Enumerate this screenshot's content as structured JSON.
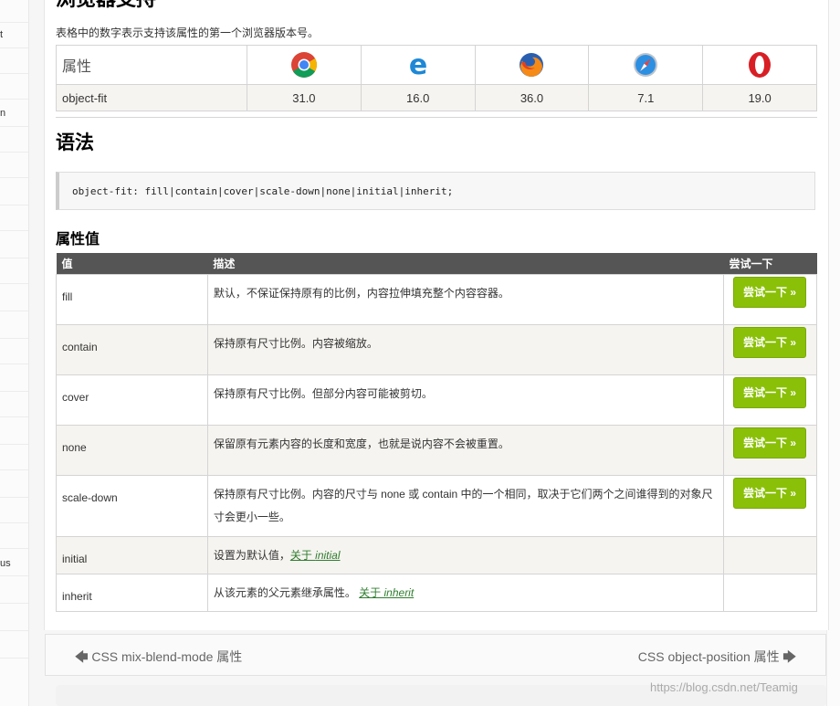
{
  "sidebar": {
    "fragments": [
      "t",
      "n",
      "us"
    ]
  },
  "browser_support": {
    "heading": "浏览器支持",
    "note": "表格中的数字表示支持该属性的第一个浏览器版本号。",
    "property_header": "属性",
    "property": "object-fit",
    "browsers": [
      {
        "icon": "chrome-icon",
        "version": "31.0"
      },
      {
        "icon": "edge-icon",
        "version": "16.0"
      },
      {
        "icon": "firefox-icon",
        "version": "36.0"
      },
      {
        "icon": "safari-icon",
        "version": "7.1"
      },
      {
        "icon": "opera-icon",
        "version": "19.0"
      }
    ]
  },
  "syntax": {
    "heading": "语法",
    "code": "object-fit: fill|contain|cover|scale-down|none|initial|inherit;"
  },
  "values": {
    "heading": "属性值",
    "columns": [
      "值",
      "描述",
      "尝试一下"
    ],
    "try_label": "尝试一下 »",
    "rows": [
      {
        "value": "fill",
        "desc": "默认，不保证保持原有的比例，内容拉伸填充整个内容容器。"
      },
      {
        "value": "contain",
        "desc": "保持原有尺寸比例。内容被缩放。"
      },
      {
        "value": "cover",
        "desc": "保持原有尺寸比例。但部分内容可能被剪切。"
      },
      {
        "value": "none",
        "desc": "保留原有元素内容的长度和宽度，也就是说内容不会被重置。"
      },
      {
        "value": "scale-down",
        "desc": "保持原有尺寸比例。内容的尺寸与 none 或 contain 中的一个相同，取决于它们两个之间谁得到的对象尺寸会更小一些。"
      },
      {
        "value": "initial",
        "desc": "设置为默认值，",
        "link_prefix": "关于 ",
        "link_em": "initial"
      },
      {
        "value": "inherit",
        "desc": "从该元素的父元素继承属性。 ",
        "link_prefix": "关于 ",
        "link_em": "inherit"
      }
    ]
  },
  "pager": {
    "prev_label": "CSS mix-blend-mode 属性",
    "next_label": "CSS object-position 属性"
  },
  "watermark": "https://blog.csdn.net/Teamig",
  "colors": {
    "try_button": "#8ac007",
    "table_header": "#555555",
    "link": "#2f7d2f"
  }
}
